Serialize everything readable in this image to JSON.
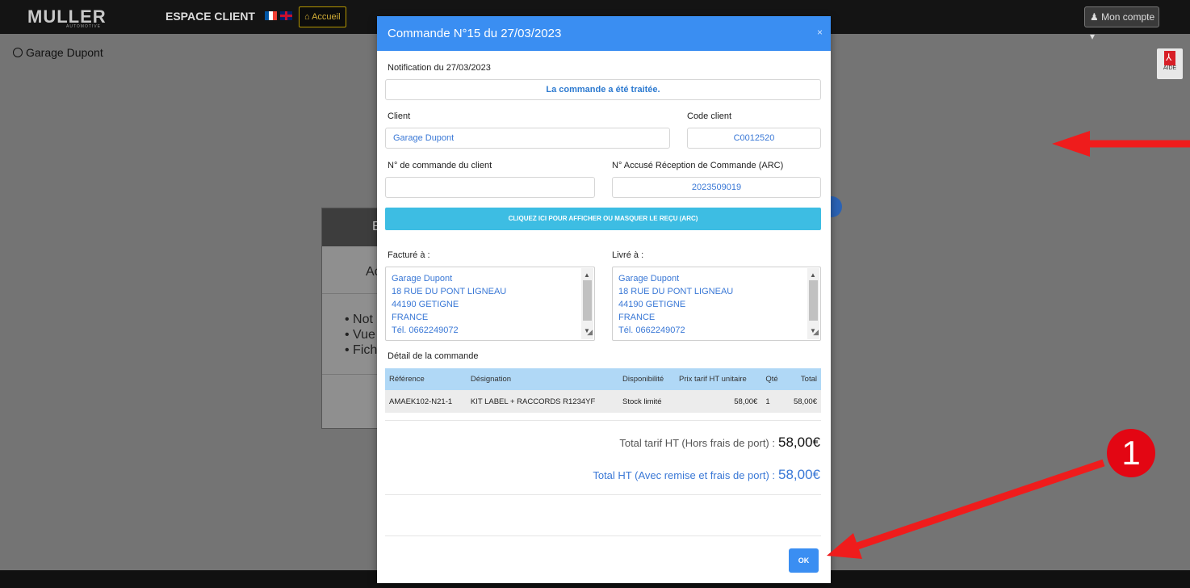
{
  "navbar": {
    "logo_text": "MULLER",
    "logo_sub": "AUTOMOTIVE",
    "title": "ESPACE CLIENT",
    "home_label": "Accueil",
    "account_label": "Mon compte"
  },
  "user": {
    "name": "Garage Dupont"
  },
  "help": {
    "label": "AIDE"
  },
  "background_card": {
    "head": "E",
    "title": "Ac",
    "items": [
      "Not",
      "Vue",
      "Fich"
    ]
  },
  "modal": {
    "title": "Commande N°15 du 27/03/2023",
    "close": "×",
    "notification_label": "Notification du 27/03/2023",
    "notification_text": "La commande a été traitée.",
    "client_label": "Client",
    "client_value": "Garage Dupont",
    "code_label": "Code client",
    "code_value": "C0012520",
    "order_no_label": "N° de commande du client",
    "order_no_value": "",
    "arc_label": "N° Accusé Réception de Commande (ARC)",
    "arc_value": "2023509019",
    "toggle_label": "CLIQUEZ ICI POUR AFFICHER OU MASQUER LE REÇU (ARC)",
    "billed_label": "Facturé à :",
    "billed_lines": [
      "Garage Dupont",
      "18 RUE DU PONT LIGNEAU",
      "44190 GETIGNE",
      "FRANCE",
      "Tél. 0662249072"
    ],
    "delivered_label": "Livré à :",
    "delivered_lines": [
      "Garage Dupont",
      "18 RUE DU PONT LIGNEAU",
      "44190 GETIGNE",
      "FRANCE",
      "Tél. 0662249072"
    ],
    "detail_label": "Détail de la commande",
    "table": {
      "headers": [
        "Référence",
        "Désignation",
        "Disponibilité",
        "Prix tarif HT unitaire",
        "Qté",
        "Total"
      ],
      "rows": [
        [
          "AMAEK102-N21-1",
          "KIT LABEL + RACCORDS R1234YF",
          "Stock limité",
          "58,00€",
          "1",
          "58,00€"
        ]
      ]
    },
    "total_tarif_label": "Total tarif HT (Hors frais de port) :",
    "total_tarif_value": "58,00€",
    "total_ht_label": "Total HT (Avec remise et frais de port) :",
    "total_ht_value": "58,00€",
    "ok_label": "OK"
  },
  "annotations": {
    "badge": "1",
    "color": "#ef1c1c"
  }
}
